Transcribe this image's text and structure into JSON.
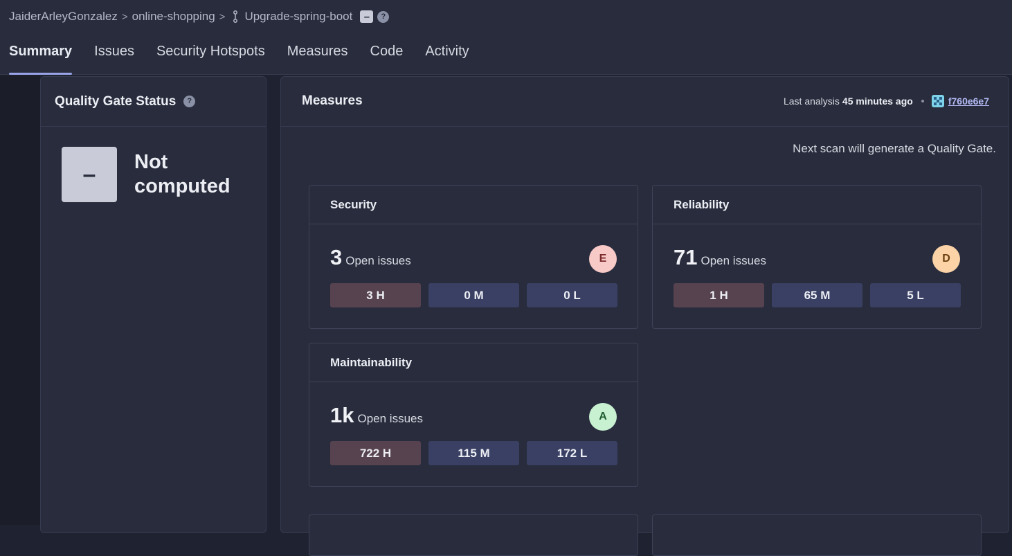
{
  "breadcrumb": {
    "organization": "JaiderArleyGonzalez",
    "project": "online-shopping",
    "branch": "Upgrade-spring-boot",
    "branch_status_badge": "–",
    "help": "?"
  },
  "tabs": [
    {
      "label": "Summary",
      "active": true
    },
    {
      "label": "Issues"
    },
    {
      "label": "Security Hotspots"
    },
    {
      "label": "Measures"
    },
    {
      "label": "Code"
    },
    {
      "label": "Activity"
    }
  ],
  "quality_gate": {
    "title": "Quality Gate Status",
    "help": "?",
    "status_symbol": "–",
    "status_text": "Not computed"
  },
  "measures": {
    "title": "Measures",
    "last_analysis_label": "Last analysis",
    "last_analysis_time": "45 minutes ago",
    "commit_hash": "f760e6e7",
    "scan_note": "Next scan will generate a Quality Gate.",
    "cards": {
      "security": {
        "title": "Security",
        "count": "3",
        "label": "Open issues",
        "grade": "E",
        "grade_bg": "#f7c9c7",
        "grade_fg": "#7a2a2a",
        "high": "3 H",
        "medium": "0 M",
        "low": "0 L"
      },
      "reliability": {
        "title": "Reliability",
        "count": "71",
        "label": "Open issues",
        "grade": "D",
        "grade_bg": "#fbd3a6",
        "grade_fg": "#6b3f10",
        "high": "1 H",
        "medium": "65 M",
        "low": "5 L"
      },
      "maintainability": {
        "title": "Maintainability",
        "count": "1k",
        "label": "Open issues",
        "grade": "A",
        "grade_bg": "#c8f1d2",
        "grade_fg": "#1e5b2f",
        "high": "722 H",
        "medium": "115 M",
        "low": "172 L"
      }
    }
  },
  "colors": {
    "accent": "#9aa3e8",
    "link": "#b3baf5",
    "severity_high_bg": "#57434f",
    "severity_other_bg": "#3a4063"
  }
}
